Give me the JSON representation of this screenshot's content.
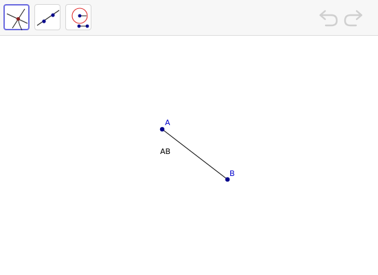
{
  "toolbar": {
    "tools": [
      {
        "name": "intersect-tool",
        "selected": true
      },
      {
        "name": "segment-tool",
        "selected": false
      },
      {
        "name": "compass-tool",
        "selected": false
      }
    ],
    "history": [
      "undo-icon",
      "redo-icon"
    ]
  },
  "construction": {
    "points": [
      {
        "label": "A"
      },
      {
        "label": "B"
      }
    ],
    "segment": {
      "label": "AB"
    },
    "colors": {
      "point": "#00008b",
      "point_label": "#0000cc",
      "segment": "#000000",
      "compass_circle": "#e03030",
      "selected_border": "#6b6bdf"
    }
  }
}
